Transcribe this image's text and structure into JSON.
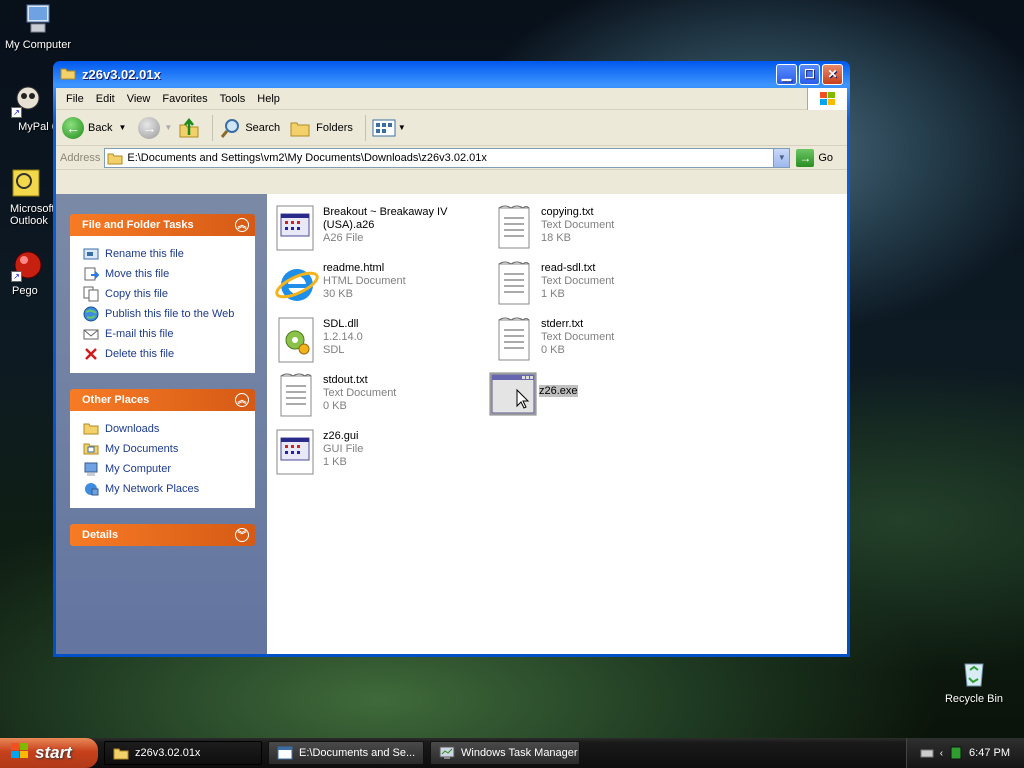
{
  "desktop": {
    "icons": [
      {
        "label": "My Computer"
      },
      {
        "label": "MyPal 6"
      },
      {
        "label": "Microsoft Outlook"
      },
      {
        "label": "Pego"
      },
      {
        "label": "Recycle Bin"
      }
    ]
  },
  "window": {
    "title": "z26v3.02.01x",
    "menu": [
      "File",
      "Edit",
      "View",
      "Favorites",
      "Tools",
      "Help"
    ],
    "toolbar": {
      "back": "Back",
      "search": "Search",
      "folders": "Folders"
    },
    "address": {
      "label": "Address",
      "value": "E:\\Documents and Settings\\vm2\\My Documents\\Downloads\\z26v3.02.01x",
      "go": "Go"
    },
    "tasks": {
      "title": "File and Folder Tasks",
      "items": [
        "Rename this file",
        "Move this file",
        "Copy this file",
        "Publish this file to the Web",
        "E-mail this file",
        "Delete this file"
      ]
    },
    "other_places": {
      "title": "Other Places",
      "items": [
        "Downloads",
        "My Documents",
        "My Computer",
        "My Network Places"
      ]
    },
    "details": {
      "title": "Details"
    },
    "files": [
      {
        "name": "Breakout ~ Breakaway IV (USA).a26",
        "type": "A26 File",
        "size": ""
      },
      {
        "name": "copying.txt",
        "type": "Text Document",
        "size": "18 KB"
      },
      {
        "name": "readme.html",
        "type": "HTML Document",
        "size": "30 KB"
      },
      {
        "name": "read-sdl.txt",
        "type": "Text Document",
        "size": "1 KB"
      },
      {
        "name": "SDL.dll",
        "type": "1.2.14.0",
        "size": "SDL"
      },
      {
        "name": "stderr.txt",
        "type": "Text Document",
        "size": "0 KB"
      },
      {
        "name": "stdout.txt",
        "type": "Text Document",
        "size": "0 KB"
      },
      {
        "name": "z26.exe",
        "type": "",
        "size": ""
      },
      {
        "name": "z26.gui",
        "type": "GUI File",
        "size": "1 KB"
      }
    ]
  },
  "taskbar": {
    "start": "start",
    "buttons": [
      "z26v3.02.01x",
      "E:\\Documents and Se...",
      "Windows Task Manager"
    ],
    "clock": "6:47 PM"
  }
}
